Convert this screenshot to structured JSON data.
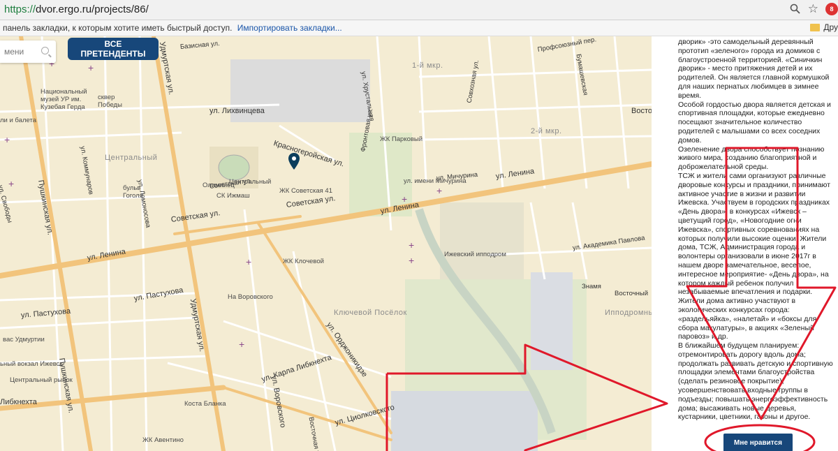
{
  "browser": {
    "url_scheme": "https://",
    "url_rest": "dvor.ergo.ru/projects/86/",
    "bookmarks_hint": "панель закладки, к которым хотите иметь быстрый доступ.",
    "bookmarks_import": "Импортировать закладки...",
    "other_bookmarks": "Дру",
    "ext_badge": "8"
  },
  "map": {
    "search_placeholder": "мени",
    "all_button": "ВСЕ ПРЕТЕНДЕНТЫ",
    "districts": [
      "Центральный",
      "Ключевой Посёлок",
      "Ипподромны",
      "1-й мкр.",
      "2-й мкр."
    ],
    "streets": [
      "ул. Лихвинцева",
      "Удмуртская ул.",
      "Красногеройская ул.",
      "ул. Ленина",
      "ул. Ленина",
      "ул. Ленина",
      "Советская ул.",
      "Советская ул.",
      "Пушкинская ул.",
      "Пушкинская ул.",
      "ул. Карла Либкнехта",
      "Либкнехта",
      "Удмуртская ул.",
      "ул. Пастухова",
      "ул. Пастухова",
      "ул. Орджоникидзе",
      "ул. Воровского",
      "ул. Циолковского",
      "ул. Академика Павлова",
      "ул. Мичурина",
      "Базисная ул.",
      "Профсоюзный пер.",
      "Восточ",
      "Восточный",
      "Знамя",
      "ул. Свободы",
      "ул. Коммунаров",
      "ул. Ломоносова",
      "Советская ул.",
      "Восточная ул.",
      "Бумашевская",
      "ул. Хрустальная",
      "Фронтовая ул.",
      "Совхозная ул."
    ],
    "pois": [
      "Национальный музей УР им. Кузебая Герда",
      "сквер Победы",
      "Олимпиец",
      "Центральный",
      "ЖК Советская 41",
      "бульв Гоголя",
      "СК Ижмаш",
      "ЖК Клочевой",
      "На Воровского",
      "ЖК Парковый",
      "ул. имени Мичурина",
      "Ижевский ипподром",
      "вас Удмуртии",
      "ьный вокзал Ижевск",
      "Центральный рынок",
      "Коста Бланка",
      "ЖК Авентино",
      "Фронтовая ул.",
      "ли и балета"
    ]
  },
  "panel": {
    "paragraphs": [
      "дворик» -это самодельный деревянный прототип «зеленого» города из домиков с благоустроенной территорией. «Синичкин дворик» - место притяжения детей и их родителей. Он является главной кормушкой для наших пернатых любимцев в зимнее время.",
      "Особой гордостью двора является детская и спортивная площадки, которые ежедневно посещают значительное количество родителей с малышами со всех соседних домов.",
      "Озеленение двора способствует познанию живого мира, созданию благоприятной и доброжелательной среды.",
      "ТСЖ и жители сами организуют различные дворовые конкурсы и праздники, принимают активное участие в жизни и развитии Ижевска. Участвуем в городских праздниках «День двора», в конкурсах «Ижевск –цветущий город», «Новогодние огни Ижевска», спортивных соревнованиях на которых получили высокие оценки. Жители дома, ТСЖ, Администрация города и волонтеры организовали в июне 2017г в нашем дворе замечательное, веселое, интересное мероприятие- «День двора», на котором каждый ребенок получил незабываемые впечатления и подарки. Жители дома активно участвуют в экологических конкурсах города: «раздельяйка», «налетай» и «боксы для сбора макулатуры», в акциях «Зеленый паровоз» и др.",
      "В ближайшем будущем планируем: отремонтировать дорогу вдоль дома; продолжать развивать детскую и спортивную площадки элементами благоустройства (сделать резиновое покрытие), усовершенствовать входные группы в подъезды; повышать энергоэффективность дома; высаживать новые деревья, кустарники, цветники, газоны и другое."
    ],
    "like_button": "Мне нравится"
  },
  "colors": {
    "accent": "#17477a",
    "annotation": "#e0182a",
    "map_bg": "#f4ecd3",
    "road": "#f2c47c"
  }
}
